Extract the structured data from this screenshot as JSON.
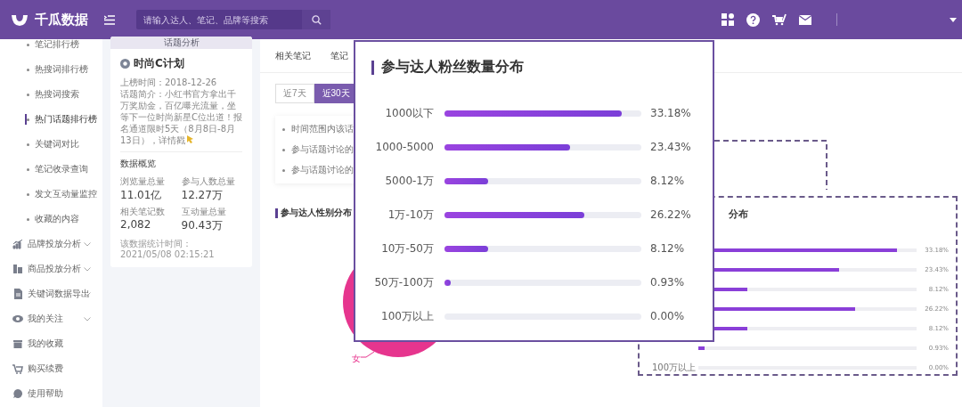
{
  "header": {
    "logo": "千瓜数据",
    "search": {
      "placeholder": "请输入达人、笔记、品牌等搜索"
    }
  },
  "sidebar": {
    "items": [
      {
        "label": "笔记排行榜",
        "kind": "sub",
        "selected": false
      },
      {
        "label": "热搜词排行榜",
        "kind": "sub",
        "selected": false
      },
      {
        "label": "热搜词搜索",
        "kind": "sub",
        "selected": false
      },
      {
        "label": "热门话题排行榜",
        "kind": "sub",
        "selected": true
      },
      {
        "label": "关键词对比",
        "kind": "sub",
        "selected": false
      },
      {
        "label": "笔记收录查询",
        "kind": "sub",
        "selected": false
      },
      {
        "label": "发文互动量监控",
        "kind": "sub",
        "selected": false
      },
      {
        "label": "收藏的内容",
        "kind": "sub",
        "selected": false
      },
      {
        "label": "品牌投放分析",
        "kind": "group",
        "expandable": true
      },
      {
        "label": "商品投放分析",
        "kind": "group",
        "expandable": true
      },
      {
        "label": "关键词数据导出",
        "kind": "group",
        "expandable": true
      },
      {
        "label": "我的关注",
        "kind": "group",
        "expandable": true
      },
      {
        "label": "我的收藏",
        "kind": "group",
        "expandable": false
      },
      {
        "label": "购买续费",
        "kind": "group",
        "expandable": false
      },
      {
        "label": "使用帮助",
        "kind": "group",
        "expandable": false
      }
    ]
  },
  "topic_card": {
    "header": "话题分析",
    "title": "时尚C计划",
    "date": "上榜时间：2018-12-26",
    "intro": "话题简介：小红书官方拿出千万奖励金，百亿曝光流量，坐等下一位时尚新星C位出道！报名通道限时5天（8月8日-8月13日），详情戳",
    "overview_title": "数据概览",
    "stats": [
      {
        "label": "浏览量总量",
        "value": "11.01亿"
      },
      {
        "label": "参与人数总量",
        "value": "12.27万"
      },
      {
        "label": "相关笔记数",
        "value": "2,082"
      },
      {
        "label": "互动量总量",
        "value": "90.43万"
      }
    ],
    "updated": "该数据统计时间：2021/05/08 02:15:21"
  },
  "main": {
    "tabs": [
      {
        "label": "相关笔记",
        "selected": false
      },
      {
        "label": "笔记",
        "selected": false
      }
    ],
    "ranges": [
      {
        "label": "近7天",
        "selected": false
      },
      {
        "label": "近30天",
        "selected": true
      }
    ],
    "summary": [
      "时间范围内该话",
      "参与话题讨论的",
      "参与话题讨论的"
    ],
    "gender_title": "参与达人性别分布",
    "gender_label": "女",
    "fan_chart": {
      "title": "分布",
      "rows": [
        {
          "value": "33.18%",
          "level": 0.91
        },
        {
          "value": "23.43%",
          "level": 0.645
        },
        {
          "value": "8.12%",
          "level": 0.225
        },
        {
          "value": "26.22%",
          "level": 0.72
        },
        {
          "value": "8.12%",
          "level": 0.225
        },
        {
          "value": "0.93%",
          "level": 0.03
        },
        {
          "label": "100万以上",
          "value": "0.00%"
        }
      ]
    }
  },
  "zoom_popup": {
    "title": "参与达人粉丝数量分布",
    "rows": [
      {
        "label": "1000以下",
        "level": 0.9,
        "value": "33.18%"
      },
      {
        "label": "1000-5000",
        "level": 0.636,
        "value": "23.43%"
      },
      {
        "label": "5000-1万",
        "level": 0.22,
        "value": "8.12%"
      },
      {
        "label": "1万-10万",
        "level": 0.711,
        "value": "26.22%"
      },
      {
        "label": "10万-50万",
        "level": 0.22,
        "value": "8.12%"
      },
      {
        "label": "50万-100万",
        "level": 0.025,
        "value": "0.93%"
      },
      {
        "label": "100万以上",
        "value": "0.00%"
      }
    ]
  }
}
